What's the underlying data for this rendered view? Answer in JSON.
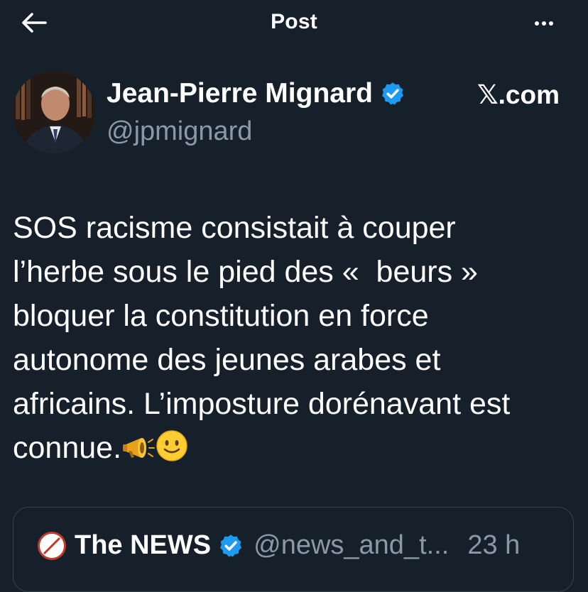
{
  "header": {
    "title": "Post",
    "back_icon": "arrow-left-icon",
    "more_icon": "more-horizontal-icon"
  },
  "author": {
    "display_name": "Jean-Pierre Mignard",
    "handle": "@jpmignard",
    "verified": true,
    "watermark": "𝕏.com"
  },
  "tweet": {
    "text": "SOS racisme consistait à couper\nl’herbe sous le pied des «  beurs »\nbloquer la constitution en force\nautonome des jeunes arabes et\nafricains. L’imposture dorénavant est\nconnue.",
    "emojis": [
      "📣",
      "🙂"
    ]
  },
  "quote": {
    "name": "The NEWS",
    "handle": "@news_and_t...",
    "time": "23 h",
    "verified": true
  },
  "colors": {
    "background": "#15202b",
    "text": "#ffffff",
    "muted": "#8b98a5",
    "verified": "#1d9bf0",
    "border": "#38444d"
  }
}
